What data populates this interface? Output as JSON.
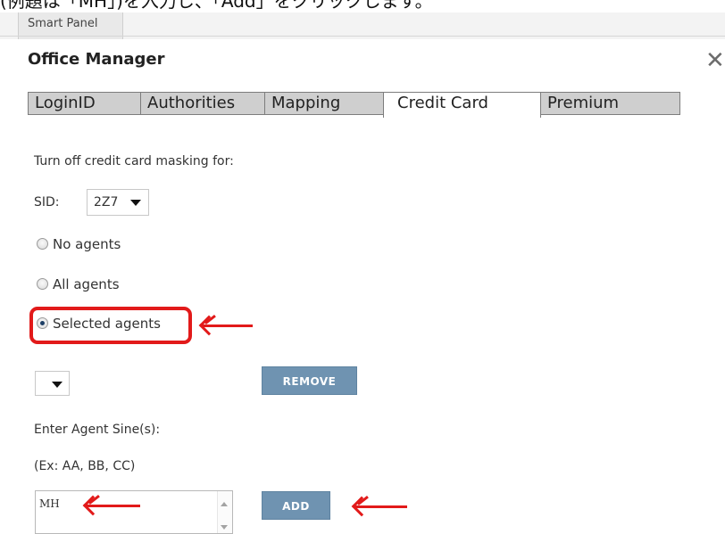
{
  "doc_line": "(例題は「MH」)を入力し、「Add」をクリックします。",
  "panel_tab": "Smart Panel",
  "dialog": {
    "title": "Office Manager",
    "close_glyph": "✕"
  },
  "tabs": [
    {
      "label": "LoginID",
      "active": false
    },
    {
      "label": "Authorities",
      "active": false
    },
    {
      "label": "Mapping",
      "active": false
    },
    {
      "label": "Credit Card",
      "active": true
    },
    {
      "label": "Premium",
      "active": false
    }
  ],
  "credit_card": {
    "intro": "Turn off credit card masking for:",
    "sid_label": "SID:",
    "sid_value": "2Z7",
    "options": [
      "No agents",
      "All agents",
      "Selected agents"
    ],
    "selected_option": "Selected agents",
    "agent_select_value": "",
    "remove_label": "REMOVE",
    "enter_label": "Enter Agent Sine(s):",
    "example": "(Ex: AA, BB, CC)",
    "sine_value": "MH",
    "add_label": "ADD"
  },
  "colors": {
    "annotation": "#e21a1a",
    "button": "#6f93b1",
    "tab_inactive": "#cfcfcf"
  },
  "icons": [
    "close-icon",
    "chevron-down-icon",
    "radio-icon",
    "arrow-left-icon"
  ]
}
